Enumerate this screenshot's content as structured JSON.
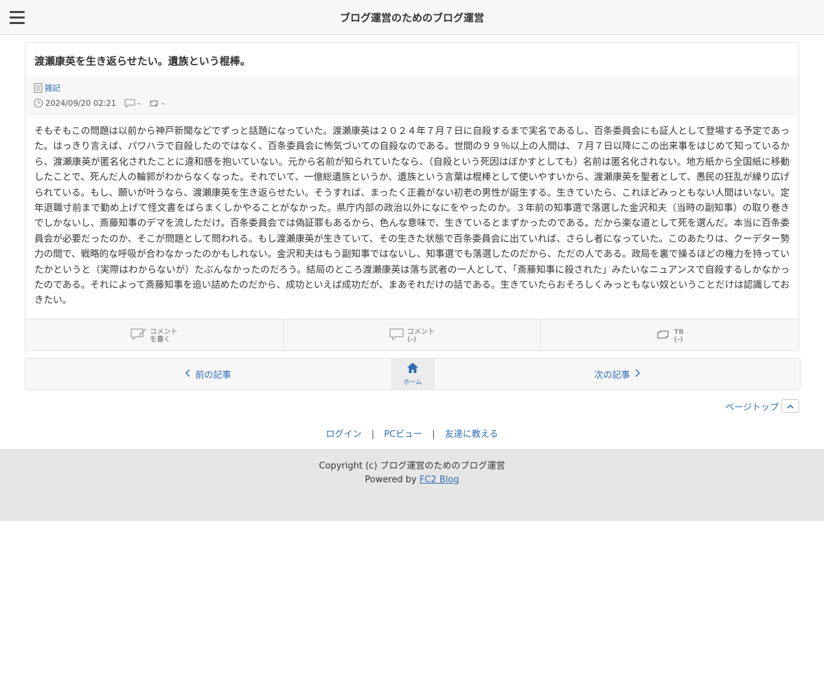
{
  "header": {
    "site_title": "ブログ運営のためのブログ運営",
    "menu_icon": "hamburger-menu-icon"
  },
  "article": {
    "title": "渡瀬康英を生き返らせたい。遺族という棍棒。",
    "category": "雑記",
    "datetime": "2024/09/20 02:21",
    "comment_count": "-",
    "trackback_count": "-",
    "body": "そもそもこの問題は以前から神戸新聞などでずっと話題になっていた。渡瀬康英は２０２４年７月７日に自殺するまで実名であるし、百条委員会にも証人として登場する予定であった。はっきり言えば、パワハラで自殺したのではなく、百条委員会に怖気づいての自殺なのである。世間の９９％以上の人間は、７月７日以降にこの出来事をはじめて知っているから、渡瀬康英が匿名化されたことに違和感を抱いていない。元から名前が知られていたなら、（自殺という死因はぼかすとしても）名前は匿名化されない。地方紙から全国紙に移動したことで、死んだ人の輪郭がわからなくなった。それでいて、一億総遺族というか、遺族という言葉は棍棒として使いやすいから、渡瀬康英を聖者として、愚民の狂乱が繰り広げられている。もし、願いが叶うなら、渡瀬康英を生き返らせたい。そうすれば、まったく正義がない初老の男性が誕生する。生きていたら、これほどみっともない人間はいない。定年退職寸前まで勤め上げて怪文書をばらまくしかやることがなかった。県庁内部の政治以外になにをやったのか。３年前の知事選で落選した金沢和夫（当時の副知事）の取り巻きでしかないし、斎藤知事のデマを流しただけ。百条委員会では偽証罪もあるから、色んな意味で、生きているとまずかったのである。だから楽な道として死を選んだ。本当に百条委員会が必要だったのか、そこが問題として問われる。もし渡瀬康英が生きていて、その生きた状態で百条委員会に出ていれば、さらし者になっていた。このあたりは、クーデター勢力の間で、戦略的な呼吸が合わなかったのかもしれない。金沢和夫はもう副知事ではないし、知事選でも落選したのだから、ただの人である。政局を裏で操るほどの権力を持っていたかというと（実際はわからないが）たぶんなかったのだろう。結局のところ渡瀬康英は落ち武者の一人として、「斎藤知事に殺された」みたいなニュアンスで自殺するしかなかったのである。それによって斎藤知事を追い詰めたのだから、成功といえば成功だが、まあそれだけの話である。生きていたらおそろしくみっともない奴ということだけは認識しておきたい。"
  },
  "actions": {
    "write_comment_line1": "コメント",
    "write_comment_line2": "を書く",
    "comment_line1": "コメント",
    "comment_line2": "(-)",
    "tb_line1": "TB",
    "tb_line2": "(-)"
  },
  "pager": {
    "prev": "前の記事",
    "home": "ホーム",
    "next": "次の記事"
  },
  "pagetop": "ページトップ",
  "footer_links": {
    "login": "ログイン",
    "sep": "|",
    "pc_view": "PCビュー",
    "tell_friend": "友達に教える"
  },
  "footer": {
    "copyright": "Copyright (c) ブログ運営のためのブログ運営",
    "powered_by": "Powered by",
    "fc2": "FC2 Blog"
  },
  "colors": {
    "link": "#2e6db4",
    "header_bg": "#f7f7f7",
    "footer_bg": "#e6e6e6"
  }
}
